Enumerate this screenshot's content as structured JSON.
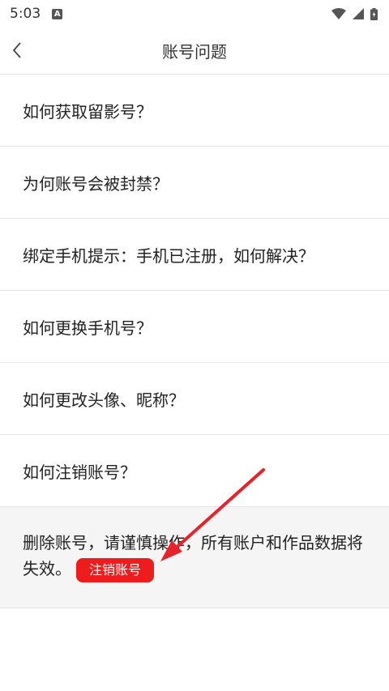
{
  "status_bar": {
    "time": "5:03",
    "notification_icon": "A"
  },
  "header": {
    "title": "账号问题"
  },
  "faq_items": [
    "如何获取留影号？",
    "为何账号会被封禁？",
    "绑定手机提示：手机已注册，如何解决？",
    "如何更换手机号？",
    "如何更改头像、昵称？",
    "如何注销账号？"
  ],
  "answer": {
    "text": "删除账号，请谨慎操作，所有账户和作品数据将失效。",
    "button_label": "注销账号"
  },
  "colors": {
    "accent": "#ee1c1c",
    "answer_bg": "#f5f5f5"
  }
}
